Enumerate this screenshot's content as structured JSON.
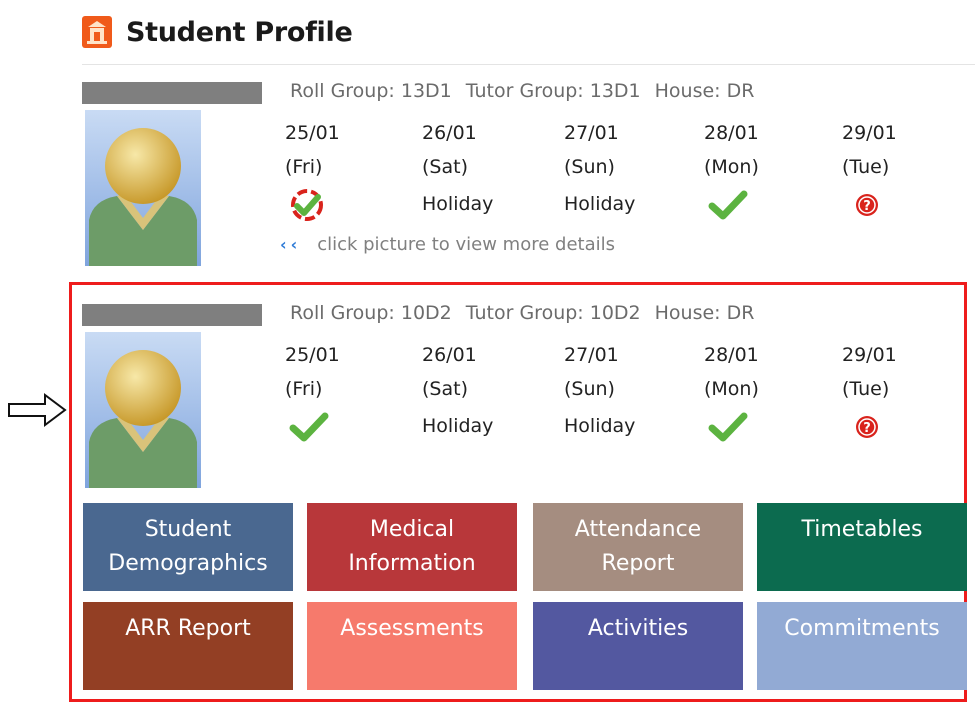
{
  "header": {
    "title": "Student Profile",
    "icon": "school-building-icon"
  },
  "students": [
    {
      "roll_group": "Roll Group: 13D1",
      "tutor_group": "Tutor Group: 13D1",
      "house": "House: DR",
      "days": [
        {
          "date": "25/01",
          "weekday": "(Fri)",
          "status": "partial-present-icon"
        },
        {
          "date": "26/01",
          "weekday": "(Sat)",
          "status": "Holiday"
        },
        {
          "date": "27/01",
          "weekday": "(Sun)",
          "status": "Holiday"
        },
        {
          "date": "28/01",
          "weekday": "(Mon)",
          "status": "check-icon"
        },
        {
          "date": "29/01",
          "weekday": "(Tue)",
          "status": "unknown-icon"
        }
      ],
      "hint": "click picture to view more details"
    },
    {
      "roll_group": "Roll Group: 10D2",
      "tutor_group": "Tutor Group: 10D2",
      "house": "House: DR",
      "days": [
        {
          "date": "25/01",
          "weekday": "(Fri)",
          "status": "check-icon"
        },
        {
          "date": "26/01",
          "weekday": "(Sat)",
          "status": "Holiday"
        },
        {
          "date": "27/01",
          "weekday": "(Sun)",
          "status": "Holiday"
        },
        {
          "date": "28/01",
          "weekday": "(Mon)",
          "status": "check-icon"
        },
        {
          "date": "29/01",
          "weekday": "(Tue)",
          "status": "unknown-icon"
        }
      ]
    }
  ],
  "tiles": [
    {
      "line1": "Student",
      "line2": "Demographics",
      "color": "#4a6890"
    },
    {
      "line1": "Medical",
      "line2": "Information",
      "color": "#b8373a"
    },
    {
      "line1": "Attendance",
      "line2": "Report",
      "color": "#a58d80"
    },
    {
      "line1": "Timetables",
      "line2": "",
      "color": "#0c6b4f"
    },
    {
      "line1": "ARR Report",
      "line2": "",
      "color": "#933f24"
    },
    {
      "line1": "Assessments",
      "line2": "",
      "color": "#f67a6c"
    },
    {
      "line1": "Activities",
      "line2": "",
      "color": "#5358a0"
    },
    {
      "line1": "Commitments",
      "line2": "",
      "color": "#92aad4"
    }
  ],
  "colors": {
    "selection_border": "#ee1c1c",
    "check": "#5cb340",
    "unknown": "#d9231c"
  }
}
